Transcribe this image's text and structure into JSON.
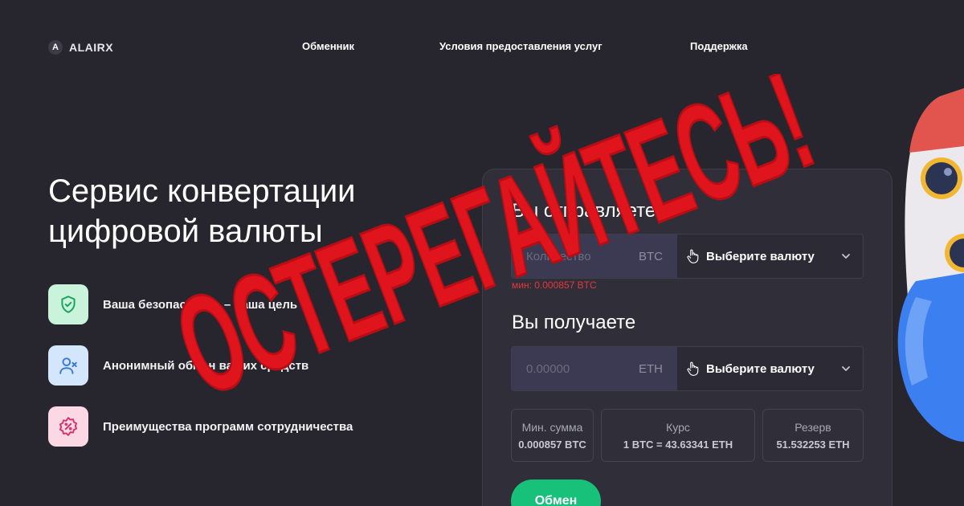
{
  "brand": {
    "logo_letter": "A",
    "name": "ALAIRX"
  },
  "nav": {
    "items": [
      "Обменник",
      "Условия предоставления услуг",
      "Поддержка"
    ]
  },
  "hero": {
    "title": "Сервис конвертации цифровой валюты"
  },
  "features": [
    {
      "icon": "shield-check-icon",
      "label": "Ваша безопасность – наша цель",
      "bg": "#c9f3db"
    },
    {
      "icon": "user-x-icon",
      "label": "Анонимный обмен ваших средств",
      "bg": "#d4e6fb"
    },
    {
      "icon": "percent-badge-icon",
      "label": "Преимущества программ сотрудничества",
      "bg": "#fcd8e4"
    }
  ],
  "exchange": {
    "send": {
      "heading": "Вы отправляете",
      "placeholder": "Количество",
      "currency": "BTC",
      "select_label": "Выберите валюту",
      "min_note": "мин: 0.000857 BTC"
    },
    "receive": {
      "heading": "Вы получаете",
      "placeholder": "0.00000",
      "currency": "ETH",
      "select_label": "Выберите валюту"
    },
    "stats": [
      {
        "label": "Мин. сумма",
        "value": "0.000857 BTC"
      },
      {
        "label": "Курс",
        "value": "1 BTC = 43.63341 ETH"
      },
      {
        "label": "Резерв",
        "value": "51.532253 ETH"
      }
    ],
    "submit_label": "Обмен"
  },
  "warning_stamp": {
    "text": "ОСТЕРЕГАЙТЕСЬ!",
    "color": "#e0141c"
  },
  "colors": {
    "background": "#27262e",
    "accent": "#17c17a",
    "error": "#e2383d"
  }
}
